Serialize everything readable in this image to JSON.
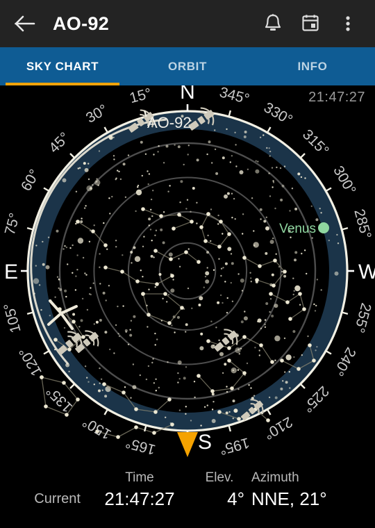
{
  "appbar": {
    "back_icon": "arrow-left-icon",
    "title": "AO-92",
    "actions": [
      {
        "name": "notifications-button",
        "icon": "bell-icon"
      },
      {
        "name": "calendar-button",
        "icon": "calendar-icon"
      },
      {
        "name": "overflow-menu-button",
        "icon": "more-vertical-icon"
      }
    ]
  },
  "tabs": [
    {
      "label": "SKY CHART",
      "active": true
    },
    {
      "label": "ORBIT",
      "active": false
    },
    {
      "label": "INFO",
      "active": false
    }
  ],
  "chart": {
    "timestamp": "21:47:27",
    "cardinals": {
      "n": "N",
      "e": "E",
      "s": "S",
      "w": "W"
    },
    "azimuth_ticks": [
      "15°",
      "30°",
      "45°",
      "60°",
      "75°",
      "105°",
      "120°",
      "135°",
      "150°",
      "165°",
      "195°",
      "210°",
      "225°",
      "240°",
      "255°",
      "285°",
      "300°",
      "315°",
      "330°",
      "345°"
    ],
    "satellite_label": "AO-92",
    "object_label": "Venus",
    "colors": {
      "sky_background": "#000000",
      "horizon_band": "#1b3449",
      "horizon_ring": "#f2f0e4",
      "elevation_grid": "#5a5a5a",
      "star": "#ece7d2",
      "constellation_line": "#8a8571",
      "track": "#efeada",
      "satellite_body": "#cfcabb",
      "venus": "#8fd6a0",
      "south_marker": "#f5a200",
      "tick_label": "#c9c9c9"
    }
  },
  "data_panel": {
    "headers": {
      "row": "",
      "time": "Time",
      "elev": "Elev.",
      "azimuth": "Azimuth"
    },
    "rows": [
      {
        "label": "Current",
        "time": "21:47:27",
        "elev": "4°",
        "azimuth": "NNE,  21°"
      }
    ]
  }
}
